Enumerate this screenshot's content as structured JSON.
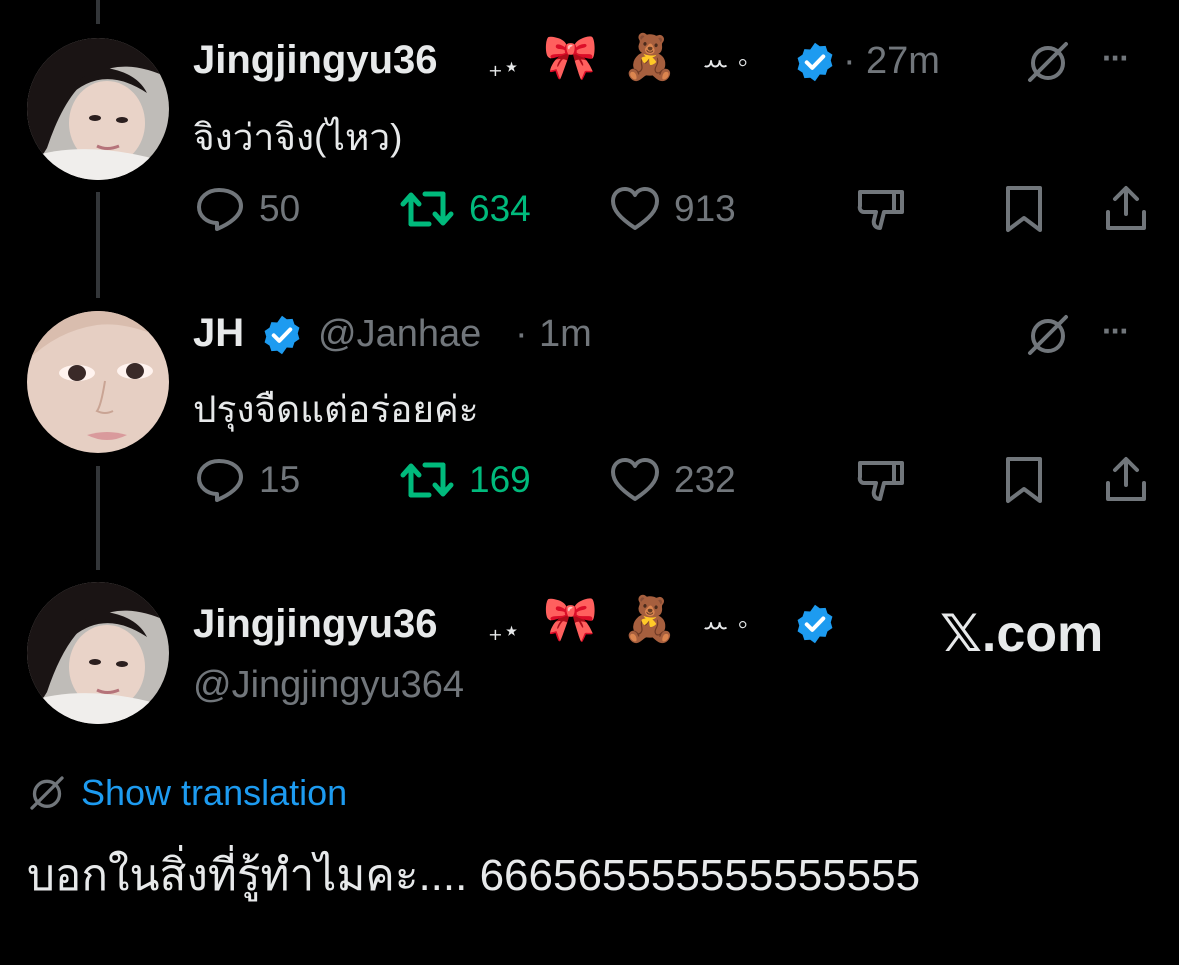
{
  "tweets": [
    {
      "display_name": "Jingjingyu36",
      "name_decor": "₊⋆",
      "emoji": [
        "🎀",
        "🧸"
      ],
      "decor_tail": "ꕀ ◦",
      "separator": "·",
      "time": "27m",
      "text": "จิงว่าจิง(ไหว)",
      "replies": "50",
      "reposts": "634",
      "likes": "913"
    },
    {
      "display_name": "JH",
      "handle": "@Janhae",
      "separator": "·",
      "time": "1m",
      "text": "ปรุงจืดแต่อร่อยค่ะ",
      "replies": "15",
      "reposts": "169",
      "likes": "232"
    }
  ],
  "main_tweet": {
    "display_name": "Jingjingyu36",
    "name_decor": "₊⋆",
    "emoji": [
      "🎀",
      "🧸"
    ],
    "decor_tail": "ꕀ ◦",
    "handle": "@Jingjingyu364",
    "translate_label": "Show translation",
    "text": "บอกในสิ่งที่รู้ทำไมคะ.... 666565555555555555"
  },
  "watermark": "𝕏.com",
  "more_label": "···",
  "colors": {
    "background": "#000000",
    "text": "#e7e9ea",
    "muted": "#71767b",
    "repost_green": "#00ba7c",
    "link_blue": "#1d9bf0",
    "verified_blue": "#1d9bf0"
  },
  "icons": [
    "reply-icon",
    "repost-icon",
    "like-icon",
    "dislike-icon",
    "bookmark-icon",
    "share-icon",
    "grok-icon",
    "more-icon",
    "verified-badge-icon",
    "translate-icon"
  ]
}
